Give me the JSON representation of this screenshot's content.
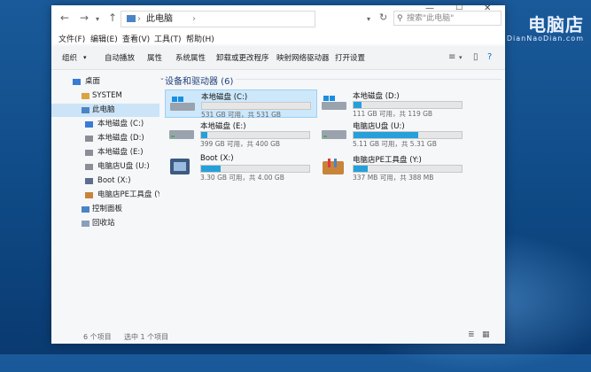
{
  "watermark": {
    "brand": "电脑店",
    "domain": "DianNaoDian.com"
  },
  "window": {
    "address": {
      "path_root_sep": "›",
      "path": "此电脑",
      "path_chevron": "›"
    },
    "search": {
      "placeholder": "搜索\"此电脑\""
    },
    "controls": {
      "minimize": "—",
      "maximize": "☐",
      "close": "✕"
    },
    "menu": [
      "文件(F)",
      "编辑(E)",
      "查看(V)",
      "工具(T)",
      "帮助(H)"
    ],
    "toolbar": [
      "组织",
      "自动播放",
      "属性",
      "系统属性",
      "卸载或更改程序",
      "映射网络驱动器",
      "打开设置"
    ],
    "sidebar": [
      {
        "label": "桌面",
        "icon": "desktop-folder-icon",
        "color": "#3a7bd5"
      },
      {
        "label": "SYSTEM",
        "icon": "user-folder-icon",
        "color": "#d9a441"
      },
      {
        "label": "此电脑",
        "icon": "computer-icon",
        "color": "#4a84c4",
        "active": true
      },
      {
        "label": "本地磁盘 (C:)",
        "icon": "system-drive-icon",
        "color": "#3a7bd5"
      },
      {
        "label": "本地磁盘 (D:)",
        "icon": "drive-icon",
        "color": "#8a8f96"
      },
      {
        "label": "本地磁盘 (E:)",
        "icon": "drive-icon",
        "color": "#8a8f96"
      },
      {
        "label": "电脑店U盘 (U:)",
        "icon": "usb-drive-icon",
        "color": "#8a8f96"
      },
      {
        "label": "Boot (X:)",
        "icon": "boot-drive-icon",
        "color": "#5a6f8c"
      },
      {
        "label": "电脑店PE工具盘 (Y",
        "icon": "tools-disk-icon",
        "color": "#c8843a"
      },
      {
        "label": "控制面板",
        "icon": "control-panel-icon",
        "color": "#4a84c4"
      },
      {
        "label": "回收站",
        "icon": "recycle-bin-icon",
        "color": "#8aa0b8"
      }
    ],
    "section_title": "设备和驱动器 (6)",
    "drives": [
      {
        "name": "本地磁盘 (C:)",
        "size": "531 GB 可用，共 531 GB",
        "used_fraction": 0.0,
        "icon": "windows-drive-icon",
        "selected": true
      },
      {
        "name": "本地磁盘 (D:)",
        "size": "111 GB 可用，共 119 GB",
        "used_fraction": 0.07,
        "icon": "windows-drive-icon"
      },
      {
        "name": "本地磁盘 (E:)",
        "size": "399 GB 可用，共 400 GB",
        "used_fraction": 0.003,
        "icon": "drive-icon"
      },
      {
        "name": "电脑店U盘 (U:)",
        "size": "5.11 GB 可用，共 5.31 GB",
        "used_fraction": 0.6,
        "icon": "usb-drive-icon"
      },
      {
        "name": "Boot (X:)",
        "size": "3.30 GB 可用，共 4.00 GB",
        "used_fraction": 0.18,
        "icon": "boot-drive-icon"
      },
      {
        "name": "电脑店PE工具盘 (Y:)",
        "size": "337 MB 可用，共 388 MB",
        "used_fraction": 0.13,
        "icon": "pe-tools-icon"
      }
    ],
    "status": {
      "count": "6 个项目",
      "selected": "选中 1 个项目"
    }
  }
}
